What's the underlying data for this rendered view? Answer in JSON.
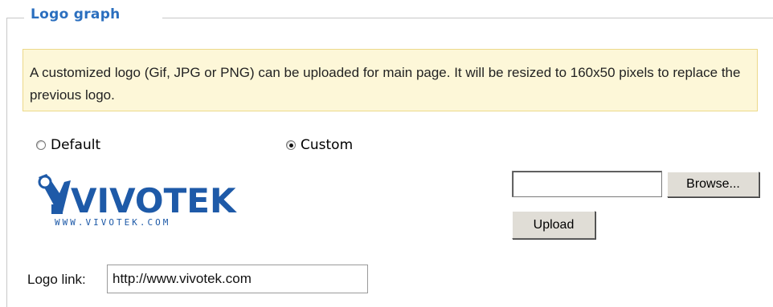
{
  "section": {
    "legend": "Logo graph",
    "notice": "A customized logo (Gif, JPG or PNG) can be uploaded for main page. It will be resized to 160x50 pixels to replace the previous logo."
  },
  "logo_choice": {
    "options": [
      {
        "label": "Default",
        "checked": false
      },
      {
        "label": "Custom",
        "checked": true
      }
    ]
  },
  "logo": {
    "brand": "VIVOTEK",
    "url_text": "WWW.VIVOTEK.COM",
    "color": "#1e5aa8"
  },
  "upload": {
    "file_value": "",
    "browse_label": "Browse...",
    "upload_label": "Upload"
  },
  "logo_link": {
    "label": "Logo link:",
    "value": "http://www.vivotek.com"
  },
  "colors": {
    "legend": "#2b6fbf",
    "notice_bg": "#fdf7d8",
    "notice_border": "#ecd98a"
  }
}
